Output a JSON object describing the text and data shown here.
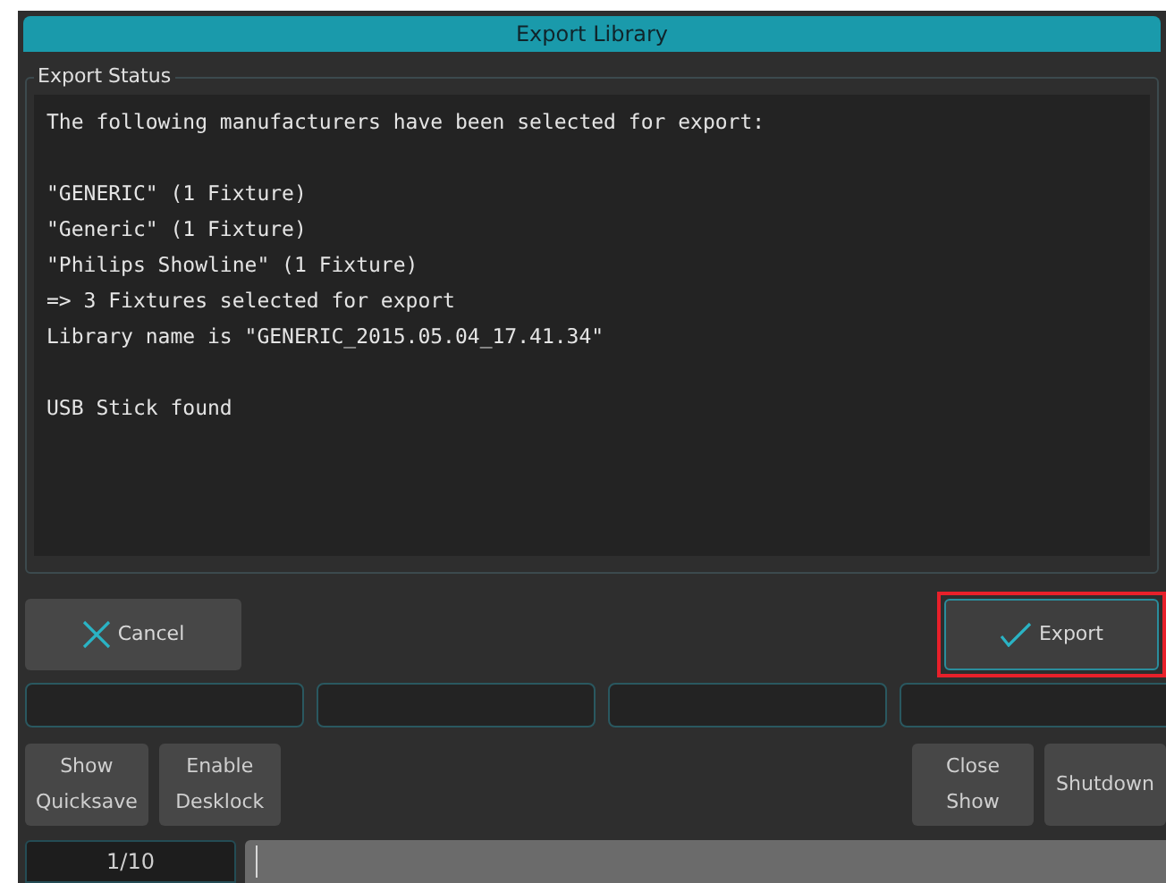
{
  "window": {
    "title": "Export Library"
  },
  "export_status": {
    "label": "Export Status",
    "paragraphs": [
      [
        "The following manufacturers have been selected for export:"
      ],
      [
        "\"GENERIC\" (1 Fixture)",
        "\"Generic\" (1 Fixture)",
        "\"Philips Showline\" (1 Fixture)",
        "=> 3 Fixtures selected for export",
        "Library name is \"GENERIC_2015.05.04_17.41.34\""
      ],
      [
        "USB Stick found"
      ]
    ]
  },
  "actions": [
    {
      "kind": "cancel",
      "label": "Cancel",
      "highlighted": false
    },
    {
      "kind": "confirm",
      "label": "Export",
      "highlighted": true
    }
  ],
  "fields": [
    {
      "kind": "text"
    },
    {
      "kind": "text"
    },
    {
      "kind": "text"
    },
    {
      "kind": "text"
    }
  ],
  "bottom_left_buttons": [
    {
      "label": "Show\nQuicksave"
    },
    {
      "label": "Enable\nDesklock"
    }
  ],
  "bottom_right_buttons": [
    {
      "label": "Close\nShow"
    },
    {
      "label": "Shutdown"
    }
  ],
  "status_bar": {
    "page": "1/10"
  }
}
